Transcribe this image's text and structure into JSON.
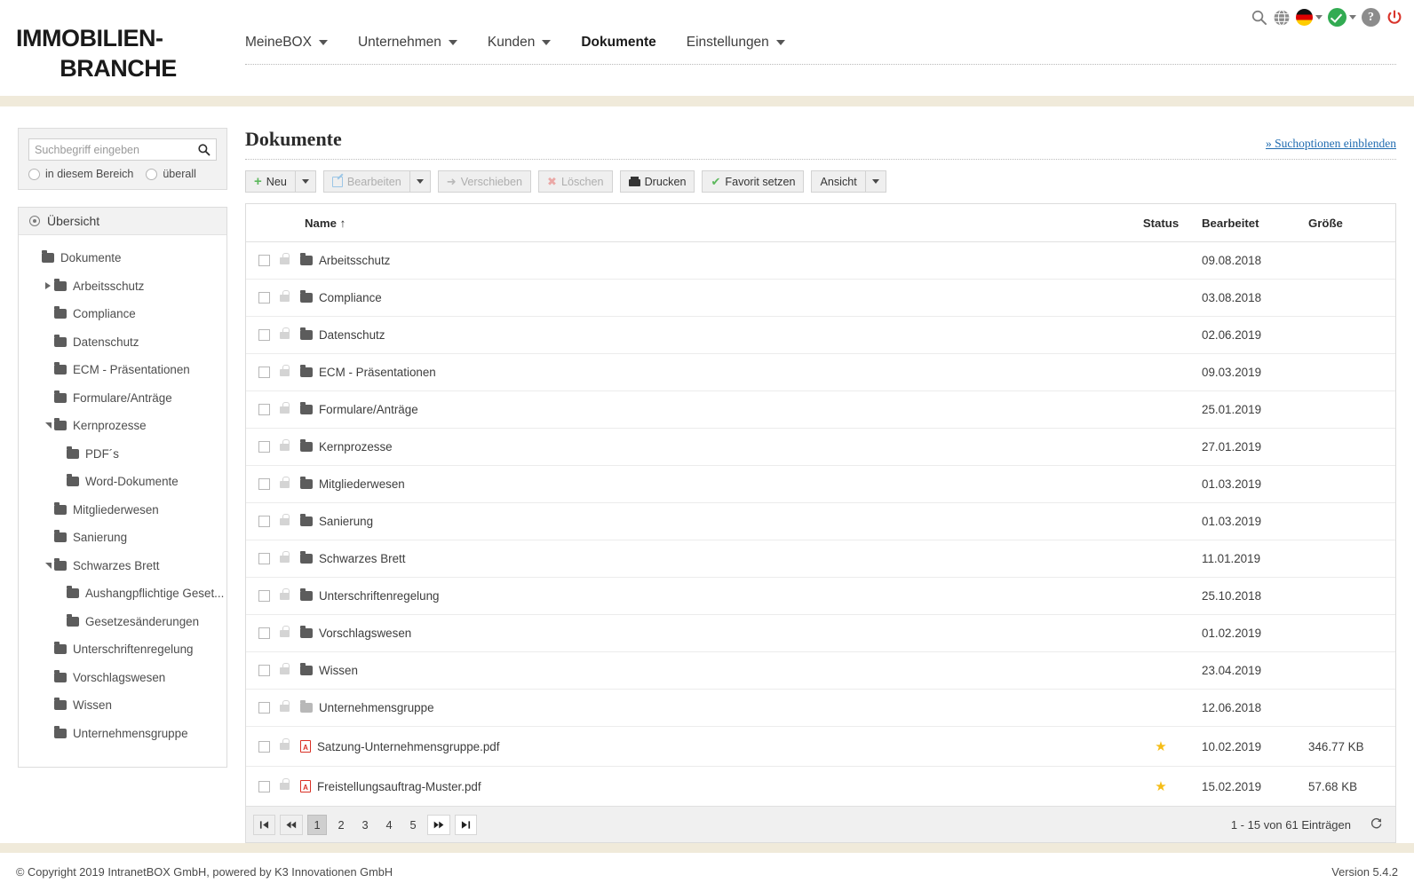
{
  "brand": {
    "line1": "IMMOBILIEN-",
    "line2": "BRANCHE"
  },
  "topnav": {
    "items": [
      {
        "label": "MeineBOX",
        "has_caret": true,
        "active": false
      },
      {
        "label": "Unternehmen",
        "has_caret": true,
        "active": false
      },
      {
        "label": "Kunden",
        "has_caret": true,
        "active": false
      },
      {
        "label": "Dokumente",
        "has_caret": false,
        "active": true
      },
      {
        "label": "Einstellungen",
        "has_caret": true,
        "active": false
      }
    ]
  },
  "topicons": [
    {
      "name": "search-icon"
    },
    {
      "name": "globe-icon"
    },
    {
      "name": "language-flag-de-icon"
    },
    {
      "name": "status-ok-icon"
    },
    {
      "name": "help-icon"
    },
    {
      "name": "logout-power-icon"
    }
  ],
  "sidebar": {
    "search": {
      "placeholder": "Suchbegriff eingeben",
      "value": "",
      "radio_area": "in diesem Bereich",
      "radio_all": "überall"
    },
    "tree_header": "Übersicht",
    "tree": [
      {
        "label": "Dokumente",
        "indent": 0,
        "twisty": "none",
        "folder": "dark"
      },
      {
        "label": "Arbeitsschutz",
        "indent": 1,
        "twisty": "right",
        "folder": "dark"
      },
      {
        "label": "Compliance",
        "indent": 1,
        "twisty": "none",
        "folder": "dark"
      },
      {
        "label": "Datenschutz",
        "indent": 1,
        "twisty": "none",
        "folder": "dark"
      },
      {
        "label": "ECM - Präsentationen",
        "indent": 1,
        "twisty": "none",
        "folder": "dark"
      },
      {
        "label": "Formulare/Anträge",
        "indent": 1,
        "twisty": "none",
        "folder": "dark"
      },
      {
        "label": "Kernprozesse",
        "indent": 1,
        "twisty": "down",
        "folder": "dark"
      },
      {
        "label": "PDF´s",
        "indent": 2,
        "twisty": "none",
        "folder": "dark"
      },
      {
        "label": "Word-Dokumente",
        "indent": 2,
        "twisty": "none",
        "folder": "dark"
      },
      {
        "label": "Mitgliederwesen",
        "indent": 1,
        "twisty": "none",
        "folder": "dark"
      },
      {
        "label": "Sanierung",
        "indent": 1,
        "twisty": "none",
        "folder": "dark"
      },
      {
        "label": "Schwarzes Brett",
        "indent": 1,
        "twisty": "down",
        "folder": "dark"
      },
      {
        "label": "Aushangpflichtige Geset...",
        "indent": 2,
        "twisty": "none",
        "folder": "dark"
      },
      {
        "label": "Gesetzesänderungen",
        "indent": 2,
        "twisty": "none",
        "folder": "dark"
      },
      {
        "label": "Unterschriftenregelung",
        "indent": 1,
        "twisty": "none",
        "folder": "dark"
      },
      {
        "label": "Vorschlagswesen",
        "indent": 1,
        "twisty": "none",
        "folder": "dark"
      },
      {
        "label": "Wissen",
        "indent": 1,
        "twisty": "none",
        "folder": "dark"
      },
      {
        "label": "Unternehmensgruppe",
        "indent": 1,
        "twisty": "none",
        "folder": "dark"
      }
    ]
  },
  "main": {
    "title": "Dokumente",
    "search_options_link": "» Suchoptionen einblenden",
    "toolbar": {
      "neu": "Neu",
      "bearbeiten": "Bearbeiten",
      "verschieben": "Verschieben",
      "loeschen": "Löschen",
      "drucken": "Drucken",
      "favorit": "Favorit setzen",
      "ansicht": "Ansicht"
    },
    "table": {
      "headers": {
        "name": "Name ↑",
        "status": "Status",
        "bearbeitet": "Bearbeitet",
        "groesse": "Größe"
      },
      "rows": [
        {
          "name": "Arbeitsschutz",
          "type": "folder",
          "status": "",
          "bearbeitet": "09.08.2018",
          "groesse": ""
        },
        {
          "name": "Compliance",
          "type": "folder",
          "status": "",
          "bearbeitet": "03.08.2018",
          "groesse": ""
        },
        {
          "name": "Datenschutz",
          "type": "folder",
          "status": "",
          "bearbeitet": "02.06.2019",
          "groesse": ""
        },
        {
          "name": "ECM - Präsentationen",
          "type": "folder",
          "status": "",
          "bearbeitet": "09.03.2019",
          "groesse": ""
        },
        {
          "name": "Formulare/Anträge",
          "type": "folder",
          "status": "",
          "bearbeitet": "25.01.2019",
          "groesse": ""
        },
        {
          "name": "Kernprozesse",
          "type": "folder",
          "status": "",
          "bearbeitet": "27.01.2019",
          "groesse": ""
        },
        {
          "name": "Mitgliederwesen",
          "type": "folder",
          "status": "",
          "bearbeitet": "01.03.2019",
          "groesse": ""
        },
        {
          "name": "Sanierung",
          "type": "folder",
          "status": "",
          "bearbeitet": "01.03.2019",
          "groesse": ""
        },
        {
          "name": "Schwarzes Brett",
          "type": "folder",
          "status": "",
          "bearbeitet": "11.01.2019",
          "groesse": ""
        },
        {
          "name": "Unterschriftenregelung",
          "type": "folder",
          "status": "",
          "bearbeitet": "25.10.2018",
          "groesse": ""
        },
        {
          "name": "Vorschlagswesen",
          "type": "folder",
          "status": "",
          "bearbeitet": "01.02.2019",
          "groesse": ""
        },
        {
          "name": "Wissen",
          "type": "folder",
          "status": "",
          "bearbeitet": "23.04.2019",
          "groesse": ""
        },
        {
          "name": "Unternehmensgruppe",
          "type": "folder-light",
          "status": "",
          "bearbeitet": "12.06.2018",
          "groesse": ""
        },
        {
          "name": "Satzung-Unternehmensgruppe.pdf",
          "type": "pdf",
          "status": "★",
          "bearbeitet": "10.02.2019",
          "groesse": "346.77 KB"
        },
        {
          "name": "Freistellungsauftrag-Muster.pdf",
          "type": "pdf",
          "status": "★",
          "bearbeitet": "15.02.2019",
          "groesse": "57.68 KB"
        }
      ]
    },
    "pager": {
      "first": "⏮",
      "prev": "⏪",
      "pages": [
        "1",
        "2",
        "3",
        "4",
        "5"
      ],
      "current": "1",
      "next": "⏩",
      "last": "⏭",
      "info": "1 - 15 von 61 Einträgen",
      "refresh": "⟳"
    }
  },
  "footer": {
    "copyright": "© Copyright 2019 IntranetBOX GmbH, powered by K3 Innovationen GmbH",
    "version": "Version 5.4.2"
  }
}
